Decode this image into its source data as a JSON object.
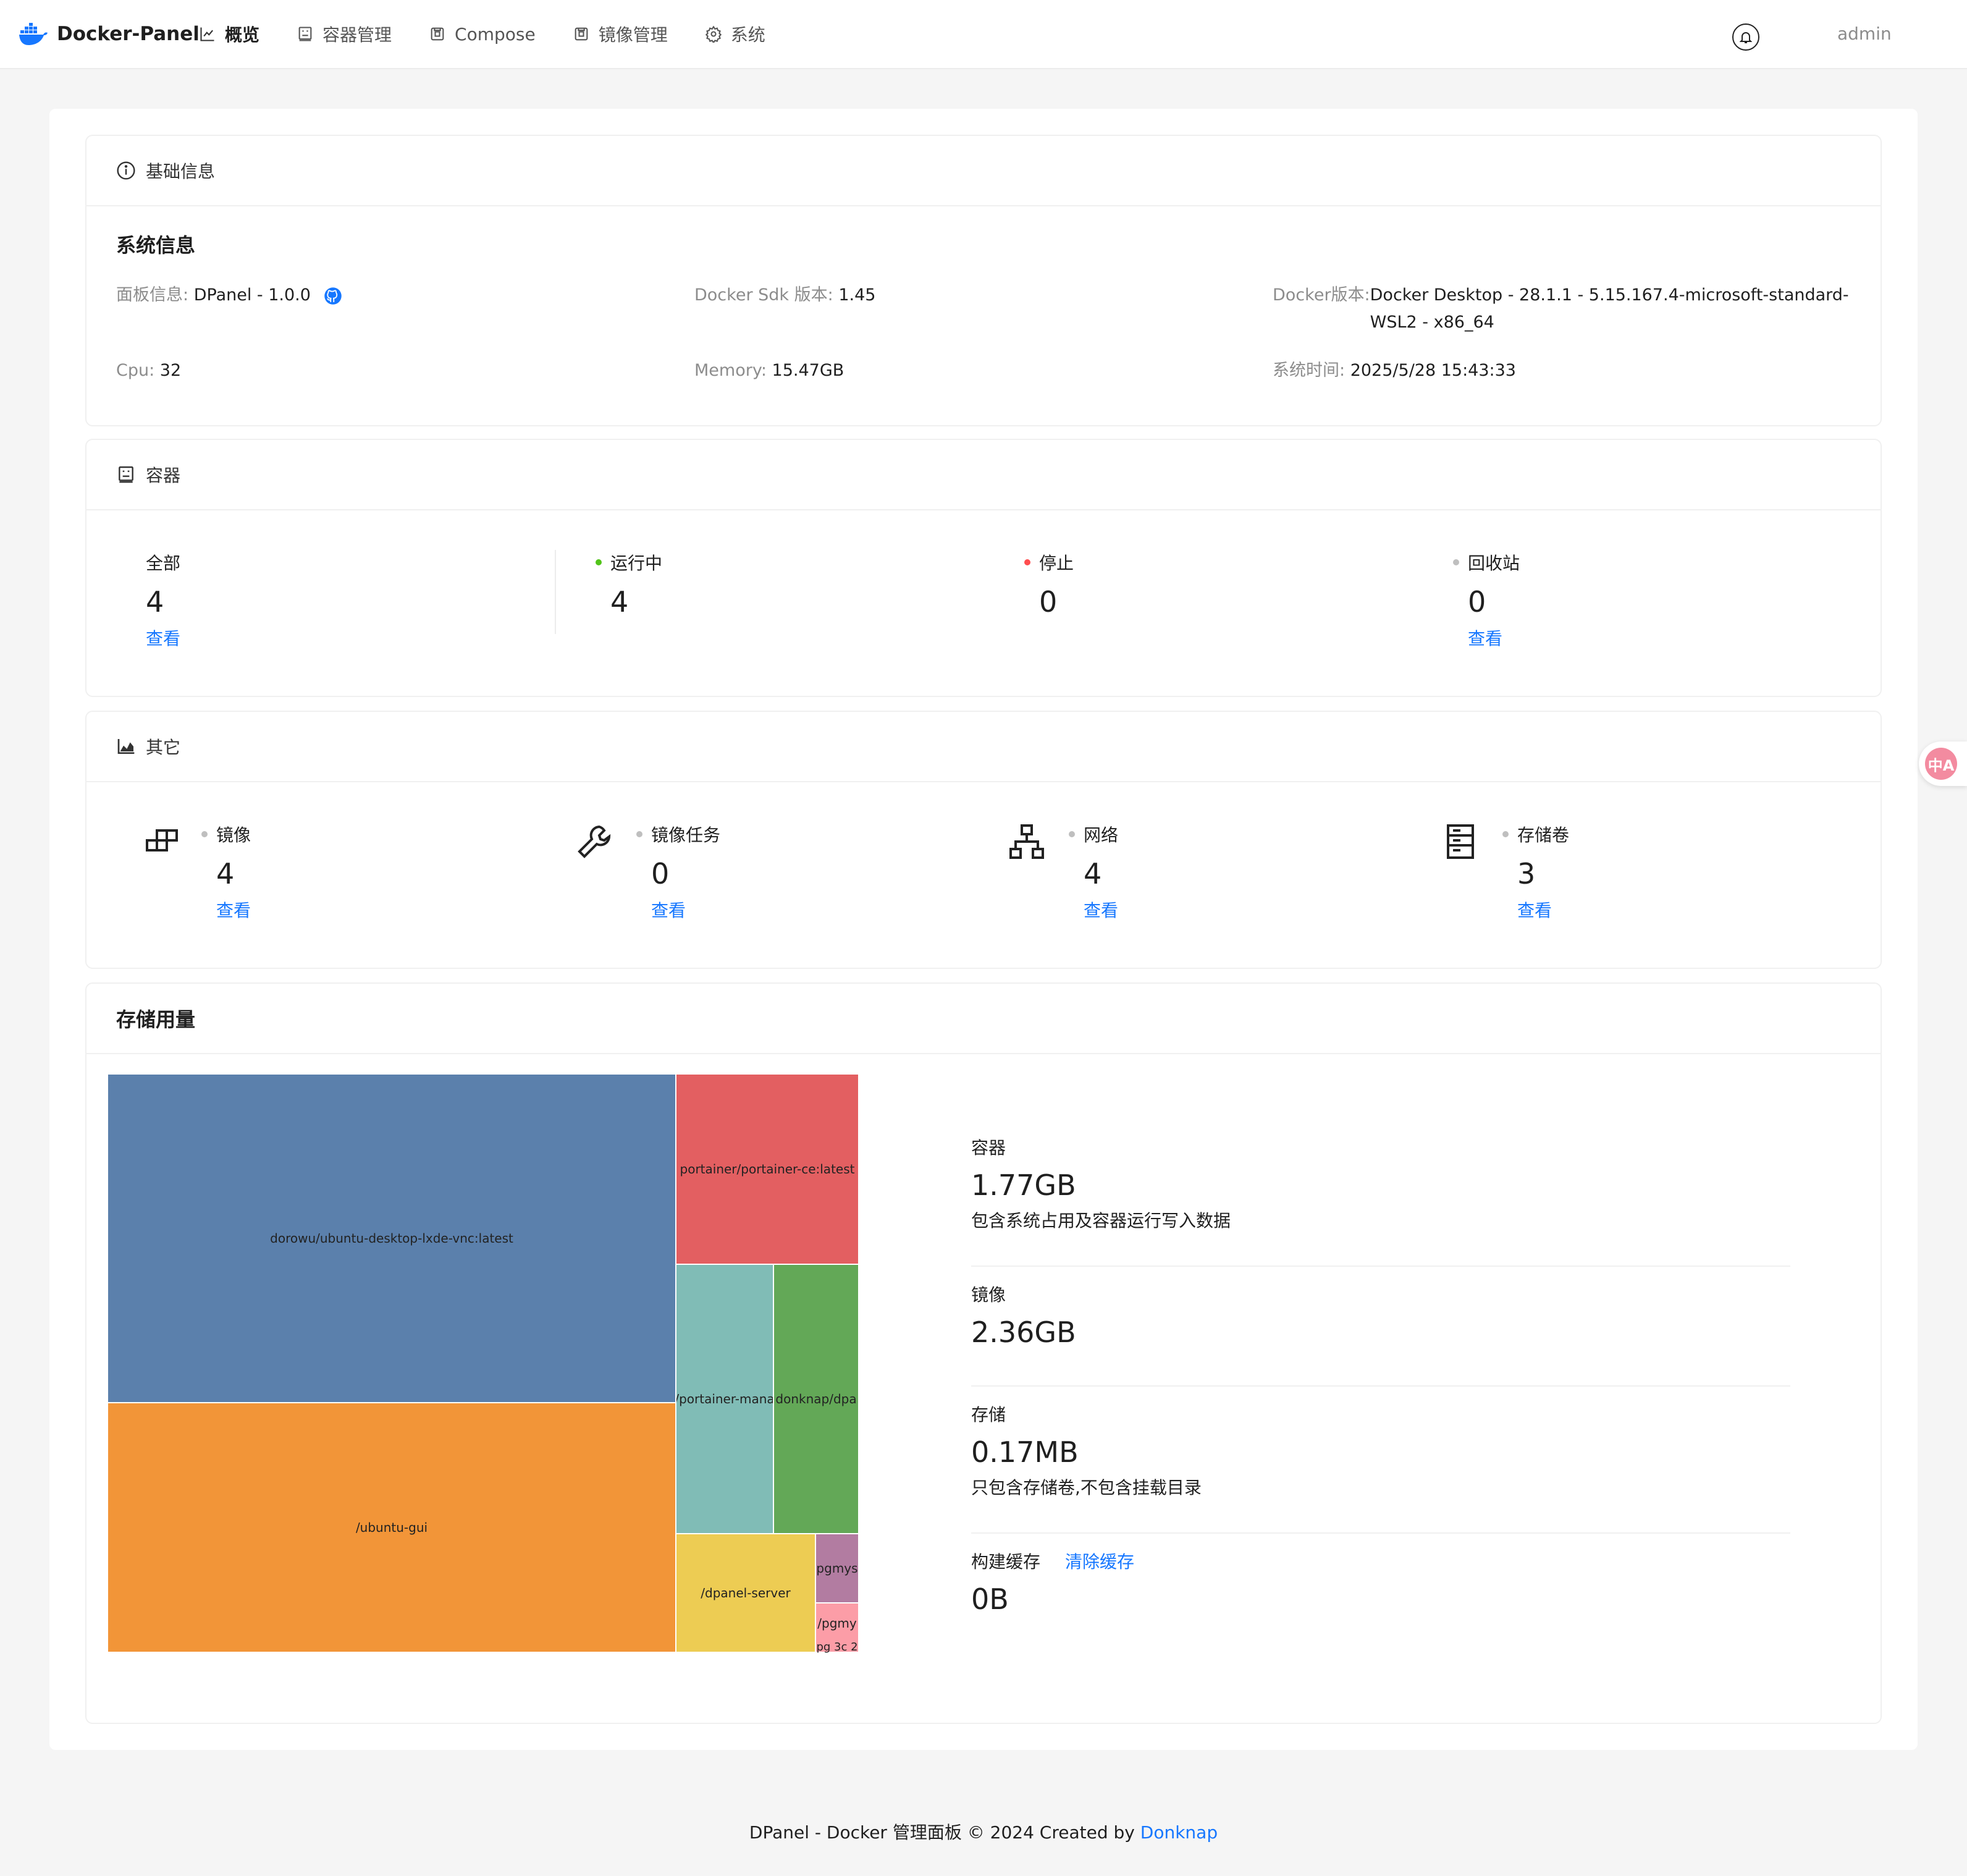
{
  "brand": {
    "name": "Docker-Panel"
  },
  "nav": {
    "items": [
      {
        "label": "概览"
      },
      {
        "label": "容器管理"
      },
      {
        "label": "Compose"
      },
      {
        "label": "镜像管理"
      },
      {
        "label": "系统"
      }
    ],
    "active_index": 0
  },
  "header": {
    "user": "admin"
  },
  "basic_info": {
    "card_title": "基础信息",
    "section_title": "系统信息",
    "panel": {
      "key": "面板信息:",
      "value": "DPanel - 1.0.0"
    },
    "sdk": {
      "key": "Docker Sdk 版本:",
      "value": "1.45"
    },
    "docker": {
      "key": "Docker版本:",
      "value_line1": "Docker Desktop - 28.1.1 - 5.15.167.4-microsoft-standard-",
      "value_line2": "WSL2 - x86_64"
    },
    "cpu": {
      "key": "Cpu:",
      "value": "32"
    },
    "memory": {
      "key": "Memory:",
      "value": "15.47GB"
    },
    "time": {
      "key": "系统时间:",
      "value": "2025/5/28 15:43:33"
    }
  },
  "containers": {
    "card_title": "容器",
    "stats": [
      {
        "label": "全部",
        "value": "4",
        "link": "查看"
      },
      {
        "label": "运行中",
        "value": "4",
        "dot_color": "#52c41a"
      },
      {
        "label": "停止",
        "value": "0",
        "dot_color": "#ff4d4f"
      },
      {
        "label": "回收站",
        "value": "0",
        "dot_color": "#bfbfbf",
        "link": "查看"
      }
    ]
  },
  "other": {
    "card_title": "其它",
    "stats": [
      {
        "label": "镜像",
        "value": "4",
        "link": "查看",
        "icon": "image-blocks-icon"
      },
      {
        "label": "镜像任务",
        "value": "0",
        "link": "查看",
        "icon": "wrench-icon"
      },
      {
        "label": "网络",
        "value": "4",
        "link": "查看",
        "icon": "network-icon"
      },
      {
        "label": "存储卷",
        "value": "3",
        "link": "查看",
        "icon": "storage-server-icon"
      }
    ]
  },
  "storage": {
    "card_title": "存储用量",
    "stats": [
      {
        "label": "容器",
        "value": "1.77GB",
        "desc": "包含系统占用及容器运行写入数据"
      },
      {
        "label": "镜像",
        "value": "2.36GB"
      },
      {
        "label": "存储",
        "value": "0.17MB",
        "desc": "只包含存储卷,不包含挂载目录"
      },
      {
        "label": "构建缓存",
        "value": "0B",
        "action": "清除缓存"
      }
    ],
    "treemap": [
      {
        "label": "dorowu/ubuntu-desktop-lxde-vnc:latest",
        "color": "#5b80ac"
      },
      {
        "label": "/ubuntu-gui",
        "color": "#f29538"
      },
      {
        "label": "portainer/portainer-ce:latest",
        "color": "#e35f61"
      },
      {
        "label": "/portainer-mana",
        "color": "#80bcb6"
      },
      {
        "label": "donknap/dpa",
        "color": "#63a857"
      },
      {
        "label": "/dpanel-server",
        "color": "#edcc53"
      },
      {
        "label": "pgmys",
        "color": "#b27ca1"
      },
      {
        "label": "/pgmy",
        "color": "#fc9da7"
      },
      {
        "label": "pg 3c 2",
        "color": "#ffffff"
      }
    ]
  },
  "footer": {
    "text": "DPanel - Docker 管理面板 © 2024 Created by",
    "link": "Donknap"
  },
  "translate_fab": {
    "glyph": "中A"
  }
}
